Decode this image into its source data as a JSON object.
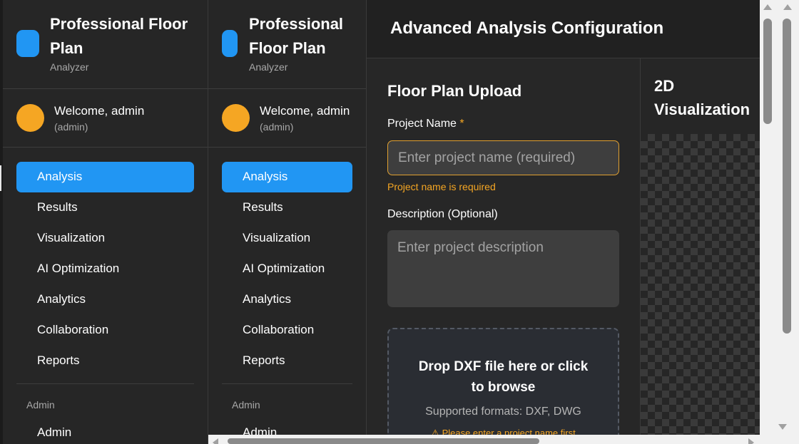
{
  "brand": {
    "title": "Professional Floor Plan",
    "title_line1_wide": "Professional Floor",
    "title_line2_wide": "Plan",
    "title_line1_narrow": "Professional",
    "title_line2_narrow": "Floor Plan",
    "subtitle": "Analyzer"
  },
  "user": {
    "welcome": "Welcome, admin",
    "role": "(admin)"
  },
  "nav": {
    "items": [
      {
        "label": "Analysis",
        "active": true
      },
      {
        "label": "Results"
      },
      {
        "label": "Visualization"
      },
      {
        "label": "AI Optimization"
      },
      {
        "label": "Analytics"
      },
      {
        "label": "Collaboration"
      },
      {
        "label": "Reports"
      }
    ],
    "section_label": "Admin",
    "admin_item": "Admin"
  },
  "main": {
    "title": "Advanced Analysis Configuration",
    "upload": {
      "title": "Floor Plan Upload",
      "project_label": "Project Name",
      "required_mark": "*",
      "project_placeholder": "Enter project name (required)",
      "project_error": "Project name is required",
      "description_label": "Description (Optional)",
      "description_placeholder": "Enter project description",
      "drop_title": "Drop DXF file here or click to browse",
      "drop_formats": "Supported formats: DXF, DWG",
      "drop_warning": "Please enter a project name first"
    },
    "viz": {
      "title_line1": "2D",
      "title_line2": "Visualization"
    }
  },
  "colors": {
    "accent": "#2196f3",
    "warning": "#f5a623",
    "background": "#262626"
  },
  "icons": {
    "brand": "floor-plan-logo",
    "warning": "warning-icon"
  }
}
